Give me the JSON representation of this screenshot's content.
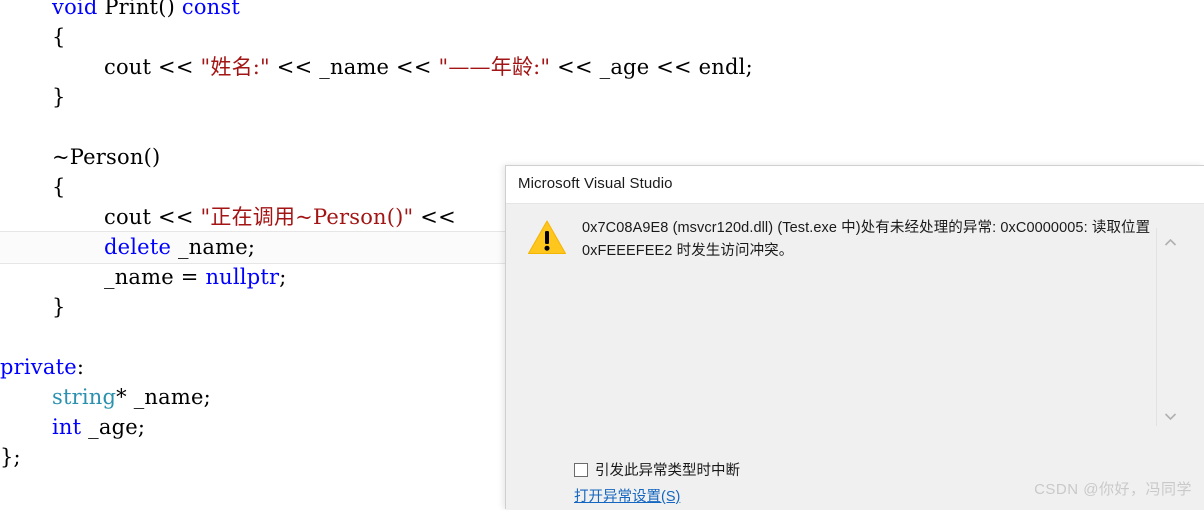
{
  "editor": {
    "language": "cpp",
    "lines": [
      {
        "indent": 1,
        "tokens": [
          {
            "t": "void ",
            "c": "kw"
          },
          {
            "t": "Print() ",
            "c": "plain"
          },
          {
            "t": "const",
            "c": "kw"
          }
        ]
      },
      {
        "indent": 1,
        "tokens": [
          {
            "t": "{",
            "c": "plain"
          }
        ]
      },
      {
        "indent": 2,
        "tokens": [
          {
            "t": "cout << ",
            "c": "plain"
          },
          {
            "t": "\"姓名:\"",
            "c": "str"
          },
          {
            "t": " << _name << ",
            "c": "plain"
          },
          {
            "t": "\"——年龄:\"",
            "c": "str"
          },
          {
            "t": " << _age << endl;",
            "c": "plain"
          }
        ]
      },
      {
        "indent": 1,
        "tokens": [
          {
            "t": "}",
            "c": "plain"
          }
        ]
      },
      {
        "indent": 1,
        "tokens": [
          {
            "t": "",
            "c": "plain"
          }
        ]
      },
      {
        "indent": 1,
        "tokens": [
          {
            "t": "~Person()",
            "c": "plain"
          }
        ]
      },
      {
        "indent": 1,
        "tokens": [
          {
            "t": "{",
            "c": "plain"
          }
        ]
      },
      {
        "indent": 2,
        "tokens": [
          {
            "t": "cout << ",
            "c": "plain"
          },
          {
            "t": "\"正在调用~Person()\"",
            "c": "str"
          },
          {
            "t": " <<",
            "c": "plain"
          }
        ]
      },
      {
        "indent": 2,
        "tokens": [
          {
            "t": "delete",
            "c": "kw"
          },
          {
            "t": " _name;",
            "c": "plain"
          }
        ]
      },
      {
        "indent": 2,
        "tokens": [
          {
            "t": "_name = ",
            "c": "plain"
          },
          {
            "t": "nullptr",
            "c": "kw"
          },
          {
            "t": ";",
            "c": "plain"
          }
        ]
      },
      {
        "indent": 1,
        "tokens": [
          {
            "t": "}",
            "c": "plain"
          }
        ]
      },
      {
        "indent": 1,
        "tokens": [
          {
            "t": "",
            "c": "plain"
          }
        ]
      },
      {
        "indent": 0,
        "tokens": [
          {
            "t": "private",
            "c": "kw"
          },
          {
            "t": ":",
            "c": "plain"
          }
        ]
      },
      {
        "indent": 1,
        "tokens": [
          {
            "t": "string",
            "c": "type"
          },
          {
            "t": "* _name;",
            "c": "plain"
          }
        ]
      },
      {
        "indent": 1,
        "tokens": [
          {
            "t": "int",
            "c": "kw"
          },
          {
            "t": " _age;",
            "c": "plain"
          }
        ]
      },
      {
        "indent": 0,
        "tokens": [
          {
            "t": "};",
            "c": "plain"
          }
        ]
      }
    ],
    "current_line_index": 8,
    "colors": {
      "keyword": "#0000ff",
      "user_type": "#2b91af",
      "string": "#a31515",
      "plain": "#000000",
      "background": "#ffffff"
    }
  },
  "dialog": {
    "title": "Microsoft Visual Studio",
    "icon": "warning-triangle-icon",
    "message": "0x7C08A9E8 (msvcr120d.dll) (Test.exe 中)处有未经处理的异常: 0xC0000005: 读取位置 0xFEEEFEE2 时发生访问冲突。",
    "checkbox": {
      "label": "引发此异常类型时中断",
      "checked": false
    },
    "link": {
      "label": "打开异常设置(S)"
    },
    "scrollbar": {
      "up_icon": "chevron-up-icon",
      "down_icon": "chevron-down-icon"
    },
    "colors": {
      "titlebar_background": "#ffffff",
      "body_background": "#f0f0f0",
      "warning_icon": "#ffc61e",
      "link": "#1566c0"
    }
  },
  "watermark": {
    "text": "CSDN @你好，冯同学"
  }
}
